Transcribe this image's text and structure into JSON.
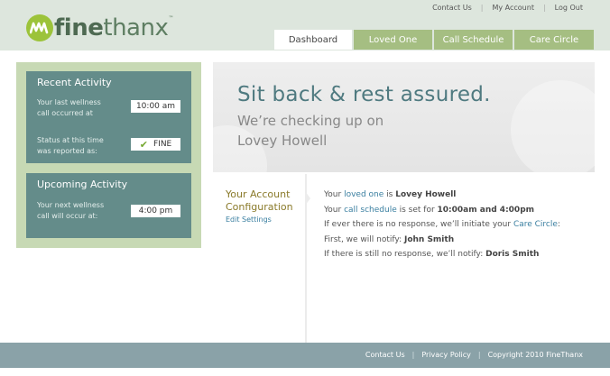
{
  "brand": {
    "name_part1": "fine",
    "name_part2": "thanx",
    "trademark": "™"
  },
  "top_links": [
    "Contact Us",
    "My Account",
    "Log Out"
  ],
  "tabs": [
    "Dashboard",
    "Loved One",
    "Call Schedule",
    "Care Circle"
  ],
  "active_tab": "Dashboard",
  "recent_activity": {
    "title": "Recent Activity",
    "last_call_label_line1": "Your last wellness",
    "last_call_label_line2": "call occurred at",
    "last_call_value": "10:00 am",
    "status_label_line1": "Status at this time",
    "status_label_line2": "was reported as:",
    "status_value": "FINE"
  },
  "upcoming_activity": {
    "title": "Upcoming Activity",
    "next_call_label_line1": "Your next wellness",
    "next_call_label_line2": "call will occur at:",
    "next_call_value": "4:00 pm"
  },
  "hero": {
    "title": "Sit back & rest assured.",
    "subtitle_line1": "We’re checking up on",
    "subtitle_line2": "Lovey Howell"
  },
  "config": {
    "heading_line1": "Your Account",
    "heading_line2": "Configuration",
    "edit_link": "Edit Settings",
    "line1_prefix": "Your ",
    "line1_link": "loved one",
    "line1_mid": " is ",
    "line1_value": "Lovey Howell",
    "line2_prefix": "Your ",
    "line2_link": "call schedule",
    "line2_mid": " is set for ",
    "line2_value": "10:00am and 4:00pm",
    "line3_prefix": "If ever there is no response, we’ll initiate your ",
    "line3_link": "Care Circle",
    "line3_suffix": ":",
    "line4_prefix": "First, we will notify: ",
    "line4_value": "John Smith",
    "line5_prefix": "If there is still no response, we’ll notify: ",
    "line5_value": "Doris Smith"
  },
  "footer": {
    "contact": "Contact Us",
    "privacy": "Privacy Policy",
    "copyright": "Copyright 2010 FineThanx"
  },
  "colors": {
    "header_bg": "#dde6dd",
    "tab_bg": "#a5be82",
    "card_bg": "#648c8a",
    "panel_bg": "#c7d9b4",
    "footer_bg": "#8aa2a8",
    "link": "#3a7fa0",
    "accent": "#9cc33a"
  }
}
